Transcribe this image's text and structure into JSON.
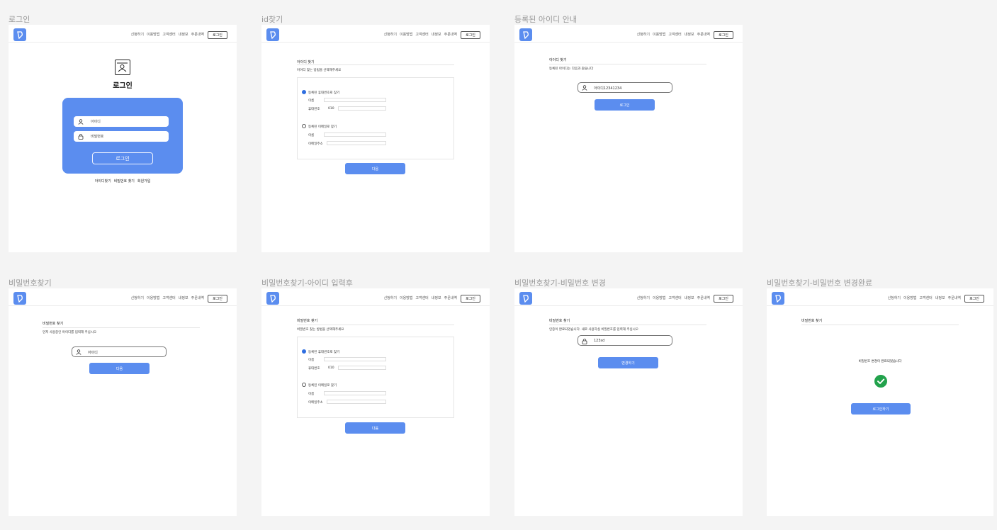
{
  "nav": {
    "items": [
      "신청하기",
      "이용방법",
      "고객센터",
      "내정보",
      "주문내역"
    ],
    "login_label": "로그인"
  },
  "frames": {
    "login": {
      "title": "로그인",
      "heading": "로그인",
      "id_placeholder": "아이디",
      "pw_placeholder": "비밀번호",
      "submit_label": "로그인",
      "links": [
        "아이디찾기",
        "비밀번호 찾기",
        "회원가입"
      ]
    },
    "find_id": {
      "title": "id찾기",
      "section_title": "아이디 찾기",
      "desc": "아이디 찾는 방법을 선택해주세요",
      "opt1_label": "등록된 휴대번호로 찾기",
      "name_label": "이름",
      "phone_label": "휴대번호",
      "phone_prefix": "010",
      "opt2_label": "등록된 이메일로 찾기",
      "email_label": "이메일주소",
      "next_label": "다음"
    },
    "id_result": {
      "title": "등록된 아이디 안내",
      "section_title": "아이디 찾기",
      "desc": "등록된 아이디는 다음과 같습니다",
      "id_value": "아이디12341234",
      "login_label": "로그인"
    },
    "find_pw": {
      "title": "비밀번호찾기",
      "section_title": "비밀번호 찾기",
      "desc": "먼저 사용중인 아이디를 입력해 주십시오",
      "id_placeholder": "아이디",
      "next_label": "다음"
    },
    "find_pw_after": {
      "title": "비밀번호찾기-아이디 입력후",
      "section_title": "비밀번호 찾기",
      "desc": "비밀번호 찾는 방법을 선택해주세요",
      "opt1_label": "등록된 휴대번호로 찾기",
      "name_label": "이름",
      "phone_label": "휴대번호",
      "phone_prefix": "010",
      "opt2_label": "등록된 이메일로 찾기",
      "email_label": "이메일주소",
      "next_label": "다음"
    },
    "pw_change": {
      "title": "비밀번호찾기-비밀번호 변경",
      "section_title": "비밀번호 찾기",
      "desc": "인증이 완료되었습니다. 새로 사용하실 비밀번호를 입력해 주십시오",
      "pw_value": "123sd",
      "submit_label": "변경하기"
    },
    "pw_done": {
      "title": "비밀번호찾기-비밀번호 변경완료",
      "section_title": "비밀번호 찾기",
      "message": "비밀번호 변경이 완료되었습니다",
      "login_label": "로그인하기"
    }
  },
  "colors": {
    "primary": "#5b8def",
    "success": "#22a24c",
    "canvas": "#f4f4f4"
  }
}
